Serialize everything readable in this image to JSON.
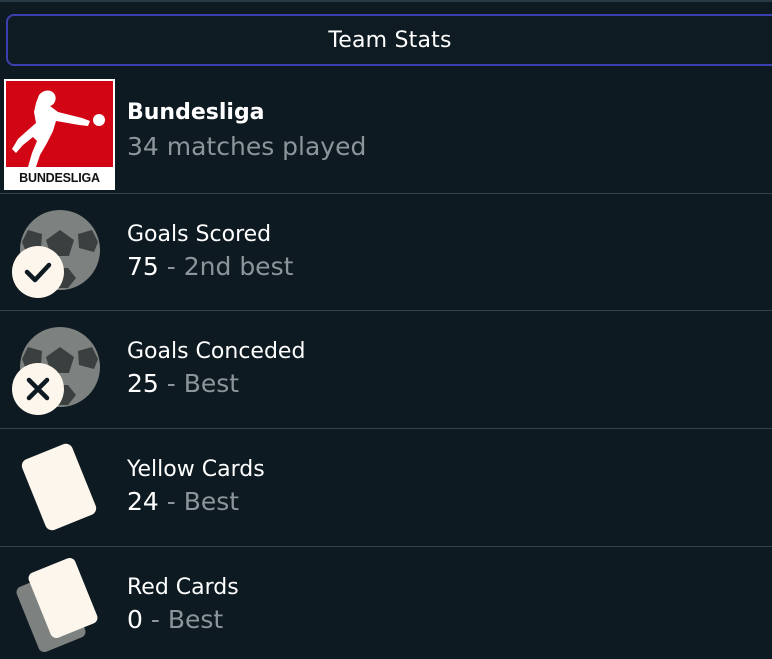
{
  "header": {
    "title": "Team Stats"
  },
  "league": {
    "name": "Bundesliga",
    "matches": "34 matches played",
    "logo_text": "BUNDESLIGA",
    "logo_color": "#d20515"
  },
  "stats": [
    {
      "label": "Goals Scored",
      "value": "75",
      "separator": "-",
      "rank": "2nd best",
      "icon": "soccer-ball-check-icon"
    },
    {
      "label": "Goals Conceded",
      "value": "25",
      "separator": "-",
      "rank": "Best",
      "icon": "soccer-ball-cross-icon"
    },
    {
      "label": "Yellow Cards",
      "value": "24",
      "separator": "-",
      "rank": "Best",
      "icon": "yellow-card-icon"
    },
    {
      "label": "Red Cards",
      "value": "0",
      "separator": "-",
      "rank": "Best",
      "icon": "red-card-icon"
    }
  ],
  "colors": {
    "background": "#0e1a21",
    "header_border": "#3c3fae",
    "muted_text": "#8b959b",
    "divider": "#34424b",
    "icon_light": "#fdf6ec",
    "icon_grey": "#7d8280"
  }
}
